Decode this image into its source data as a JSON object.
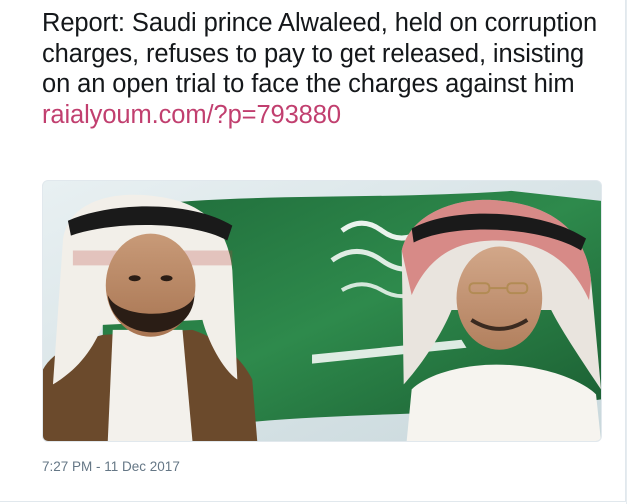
{
  "tweet": {
    "text": "Report: Saudi prince Alwaleed, held on corruption charges, refuses to pay to get released, insisting on an open trial to face the charges against him ",
    "link_text": "raialyoum.com/?p=793880",
    "timestamp": "7:27 PM - 11 Dec 2017"
  },
  "media": {
    "description_icon": "photo-two-men-saudi-flag"
  },
  "colors": {
    "text": "#14171a",
    "link": "#c13f6f",
    "meta": "#657786",
    "border": "#e1e8ed"
  }
}
